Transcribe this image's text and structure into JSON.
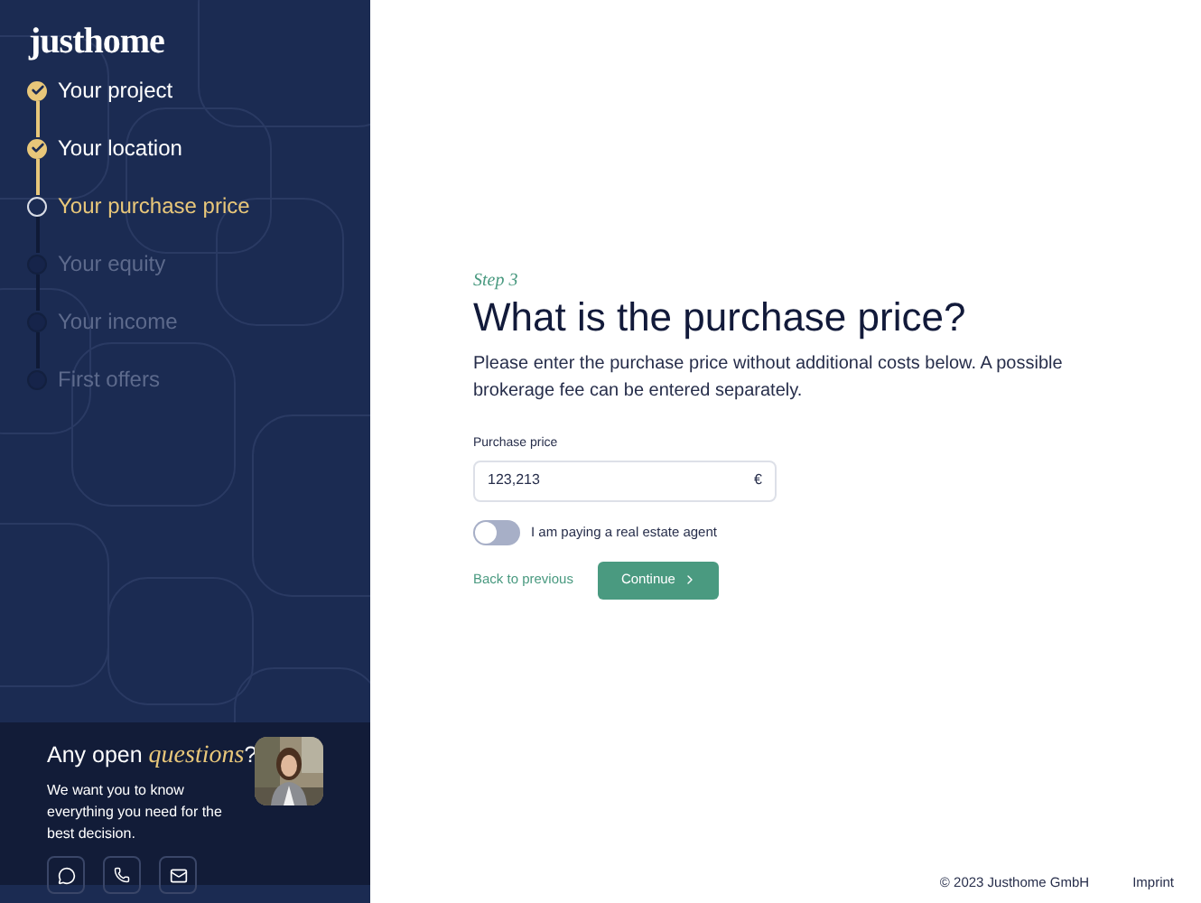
{
  "logo": "justhome",
  "steps": [
    {
      "label": "Your project",
      "kind": "done"
    },
    {
      "label": "Your location",
      "kind": "done"
    },
    {
      "label": "Your purchase price",
      "kind": "current"
    },
    {
      "label": "Your equity",
      "kind": "todo"
    },
    {
      "label": "Your income",
      "kind": "todo"
    },
    {
      "label": "First offers",
      "kind": "todo"
    }
  ],
  "help": {
    "title": "Any open *questions*?",
    "text": "We want you to know everything you need for the best decision."
  },
  "step_label": "Step 3",
  "heading": "What is the purchase price?",
  "description": "Please enter the purchase price without additional costs below. A possible brokerage fee can be entered separately.",
  "field": {
    "label": "Purchase price",
    "value": "123,213",
    "unit": "€"
  },
  "toggle": {
    "label": "I am paying a real estate agent",
    "on": false
  },
  "back": "Back to previous",
  "continue": "Continue",
  "footer": {
    "copyright": "© 2023 Justhome GmbH",
    "imprint": "Imprint"
  }
}
